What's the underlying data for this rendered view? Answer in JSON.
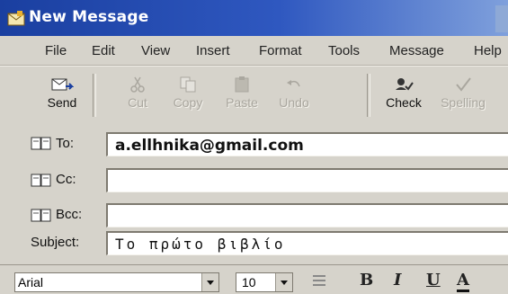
{
  "window": {
    "title": "New Message"
  },
  "menu": [
    "File",
    "Edit",
    "View",
    "Insert",
    "Format",
    "Tools",
    "Message",
    "Help"
  ],
  "toolbar": [
    {
      "label": "Send",
      "icon": "send-icon",
      "enabled": true
    },
    {
      "label": "Cut",
      "icon": "scissors-icon",
      "enabled": false
    },
    {
      "label": "Copy",
      "icon": "copy-icon",
      "enabled": false
    },
    {
      "label": "Paste",
      "icon": "paste-icon",
      "enabled": false
    },
    {
      "label": "Undo",
      "icon": "undo-icon",
      "enabled": false
    },
    {
      "label": "Check",
      "icon": "check-names-icon",
      "enabled": true
    },
    {
      "label": "Spelling",
      "icon": "spelling-icon",
      "enabled": false
    }
  ],
  "fields": {
    "to_label": "To:",
    "to_value": "a.ellhnika@gmail.com",
    "cc_label": "Cc:",
    "cc_value": "",
    "bcc_label": "Bcc:",
    "bcc_value": "",
    "subject_label": "Subject:",
    "subject_value": "Το πρώτο βιβλίο"
  },
  "format": {
    "font": "Arial",
    "size": "10",
    "bold": "B",
    "italic": "I",
    "underline": "U",
    "color": "A"
  },
  "colors": {
    "titlebar": "#1a3fa0",
    "chrome": "#d6d3cb"
  }
}
